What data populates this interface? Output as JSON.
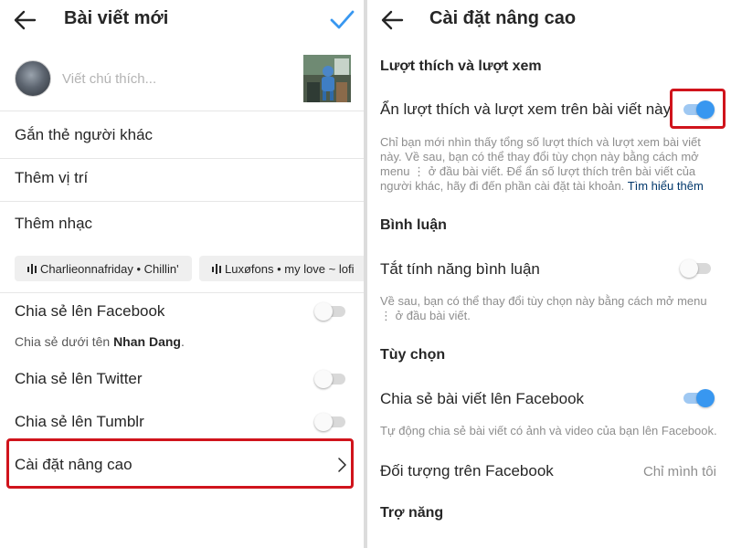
{
  "left": {
    "title": "Bài viết mới",
    "caption_placeholder": "Viết chú thích...",
    "items": {
      "tag_people": "Gắn thẻ người khác",
      "add_location": "Thêm vị trí",
      "add_music": "Thêm nhạc"
    },
    "music_chips": [
      "Charlieonnafriday • Chillin'",
      "Luxøfons • my love ~ lofi"
    ],
    "share": {
      "facebook_label": "Chia sẻ lên Facebook",
      "facebook_note_prefix": "Chia sẻ dưới tên",
      "facebook_note_name": "Nhan Dang",
      "facebook_note_suffix": ".",
      "twitter_label": "Chia sẻ lên Twitter",
      "tumblr_label": "Chia sẻ lên Tumblr"
    },
    "advanced_label": "Cài đặt nâng cao"
  },
  "right": {
    "title": "Cài đặt nâng cao",
    "likes_section": "Lượt thích và lượt xem",
    "hide_likes_label": "Ẩn lượt thích và lượt xem trên bài viết này",
    "hide_likes_desc": "Chỉ bạn mới nhìn thấy tổng số lượt thích và lượt xem bài viết này. Về sau, bạn có thể thay đổi tùy chọn này bằng cách mở menu ⋮ ở đầu bài viết. Để ẩn số lượt thích trên bài viết của người khác, hãy đi đến phần cài đặt tài khoản.",
    "learn_more": "Tìm hiểu thêm",
    "comments_section": "Bình luận",
    "turn_off_comments_label": "Tắt tính năng bình luận",
    "comments_desc": "Về sau, bạn có thể thay đổi tùy chọn này bằng cách mở menu ⋮ ở đầu bài viết.",
    "options_section": "Tùy chọn",
    "share_fb_label": "Chia sẻ bài viết lên Facebook",
    "share_fb_desc": "Tự động chia sẻ bài viết có ảnh và video của bạn lên Facebook.",
    "fb_audience_label": "Đối tượng trên Facebook",
    "fb_audience_value": "Chỉ mình tôi",
    "accessibility_section": "Trợ năng"
  },
  "toggles": {
    "share_facebook": false,
    "share_twitter": false,
    "share_tumblr": false,
    "hide_likes": true,
    "turn_off_comments": false,
    "auto_share_facebook": true
  },
  "icons": {
    "back": "arrow-left-icon",
    "confirm": "checkmark-icon",
    "music": "audio-bars-icon",
    "more": "chevron-right-icon"
  },
  "colors": {
    "accent": "#3897f0",
    "highlight": "#d0141c",
    "link": "#00376b"
  }
}
